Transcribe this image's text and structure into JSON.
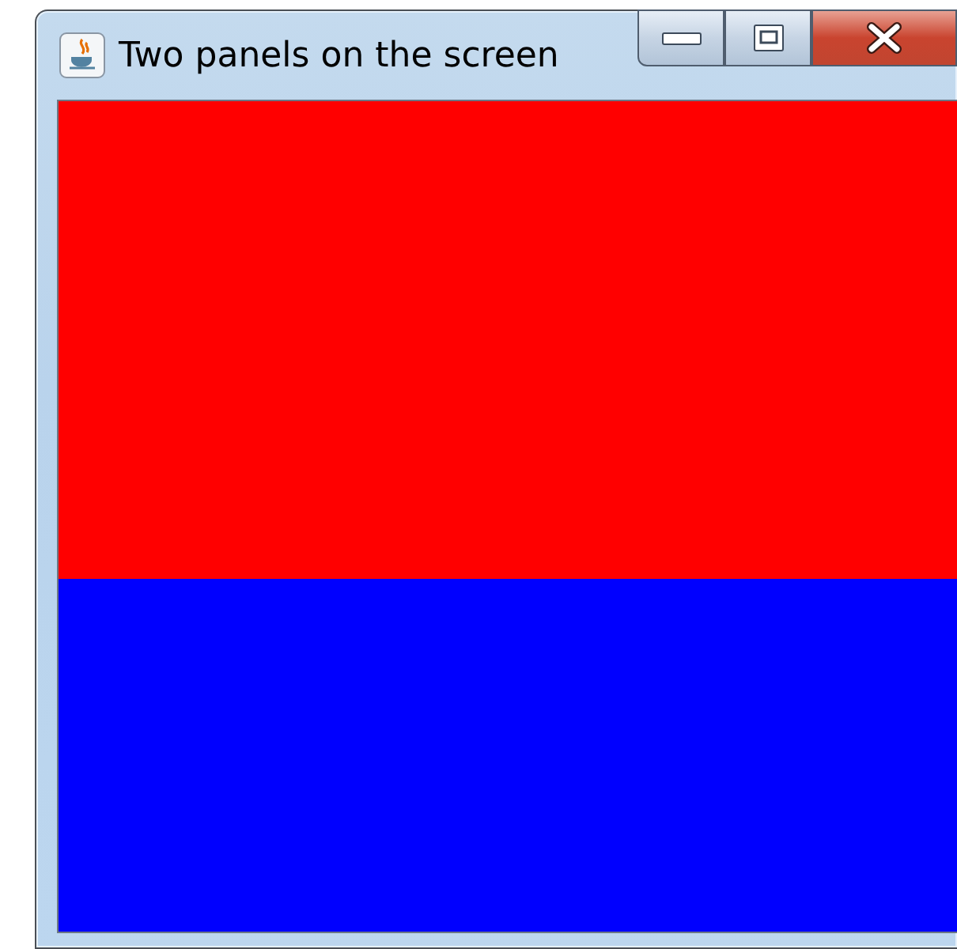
{
  "window": {
    "title": "Two panels on the screen"
  },
  "panels": [
    {
      "color": "#ff0000"
    },
    {
      "color": "#0000ff"
    }
  ]
}
